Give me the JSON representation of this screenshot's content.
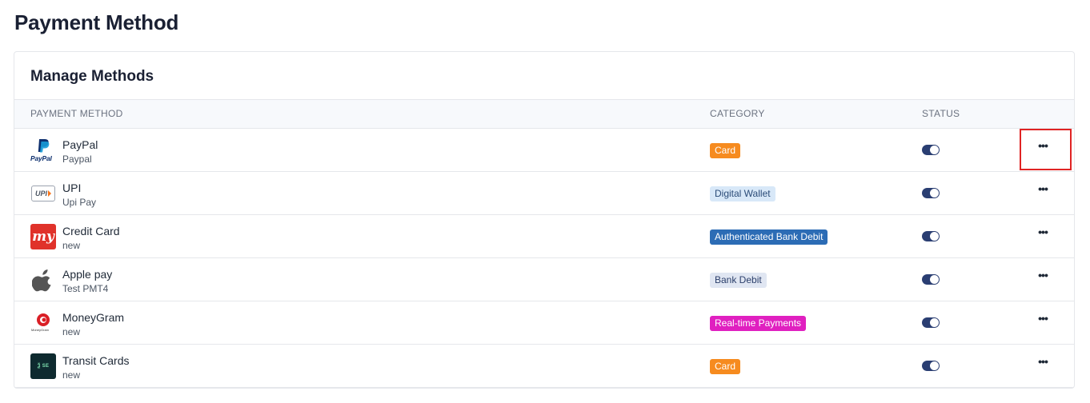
{
  "page": {
    "title": "Payment Method"
  },
  "card": {
    "title": "Manage Methods"
  },
  "table": {
    "headers": {
      "method": "PAYMENT METHOD",
      "category": "CATEGORY",
      "status": "STATUS"
    },
    "rows": [
      {
        "name": "PayPal",
        "sub": "Paypal",
        "logo": "paypal-logo",
        "category": "Card",
        "badge_bg": "#f68b1f",
        "badge_fg": "#ffffff",
        "enabled": true,
        "more": "•••"
      },
      {
        "name": "UPI",
        "sub": "Upi Pay",
        "logo": "upi-logo",
        "category": "Digital Wallet",
        "badge_bg": "#d8e8f8",
        "badge_fg": "#2b4b77",
        "enabled": true,
        "more": "•••"
      },
      {
        "name": "Credit Card",
        "sub": "new",
        "logo": "makemytrip-logo",
        "category": "Authenticated Bank Debit",
        "badge_bg": "#2c6cb5",
        "badge_fg": "#ffffff",
        "enabled": true,
        "more": "•••"
      },
      {
        "name": "Apple pay",
        "sub": "Test PMT4",
        "logo": "apple-logo",
        "category": "Bank Debit",
        "badge_bg": "#e0e6f2",
        "badge_fg": "#2b3f6b",
        "enabled": true,
        "more": "•••"
      },
      {
        "name": "MoneyGram",
        "sub": "new",
        "logo": "moneygram-logo",
        "category": "Real-time Payments",
        "badge_bg": "#e020c0",
        "badge_fg": "#ffffff",
        "enabled": true,
        "more": "•••"
      },
      {
        "name": "Transit Cards",
        "sub": "new",
        "logo": "transit-card-logo",
        "category": "Card",
        "badge_bg": "#f68b1f",
        "badge_fg": "#ffffff",
        "enabled": true,
        "more": "•••"
      }
    ]
  },
  "logo_text": {
    "paypal": "PayPal",
    "upi": "UPI",
    "mmt": "my",
    "moneygram": "MoneyGram",
    "transit": "Ѯ SE"
  },
  "colors": {
    "toggle_on": "#2a3e72",
    "highlight": "#e02424"
  }
}
